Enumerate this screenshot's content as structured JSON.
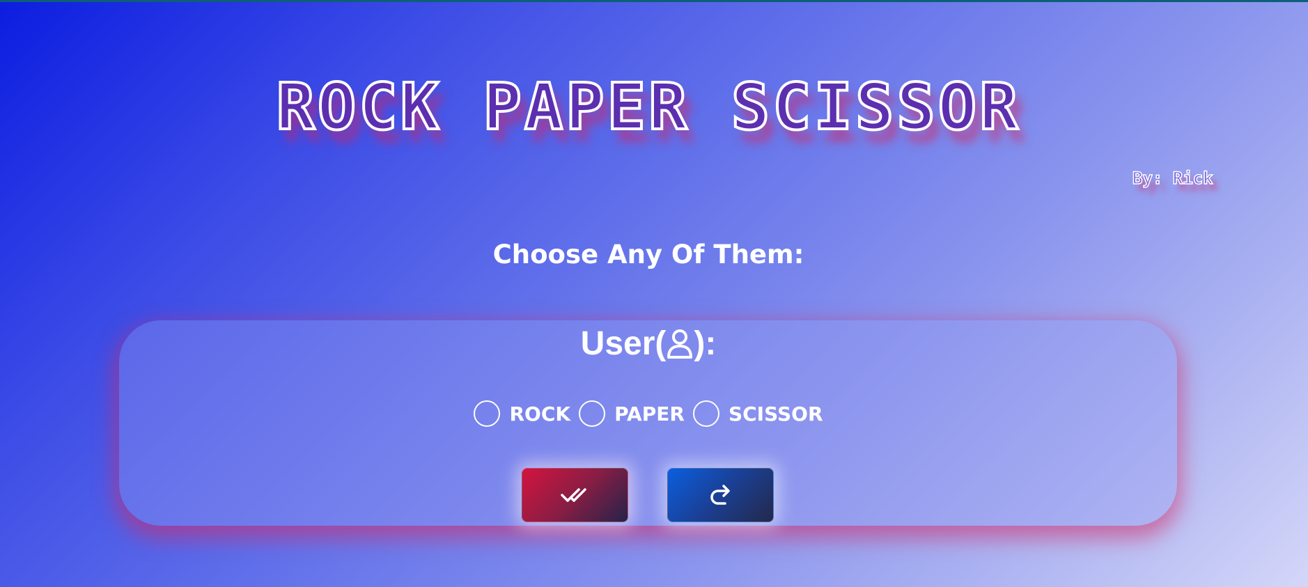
{
  "header": {
    "title": "ROCK PAPER SCISSOR",
    "author": "By: Rick"
  },
  "prompt": {
    "text": "Choose Any Of Them:"
  },
  "panel": {
    "heading_prefix": "User(",
    "heading_suffix": "):",
    "heading_icon": "user-icon",
    "options": [
      {
        "label": "ROCK",
        "selected": false
      },
      {
        "label": "PAPER",
        "selected": false
      },
      {
        "label": "SCISSOR",
        "selected": false
      }
    ],
    "buttons": {
      "submit_icon": "double-check-icon",
      "reset_icon": "redo-arrow-icon"
    }
  },
  "colors": {
    "background_start": "#0c1de0",
    "background_end": "#d4d6f8",
    "submit_button": "#d4143f",
    "reset_button": "#0a5fe0",
    "glow": "#d62864"
  }
}
